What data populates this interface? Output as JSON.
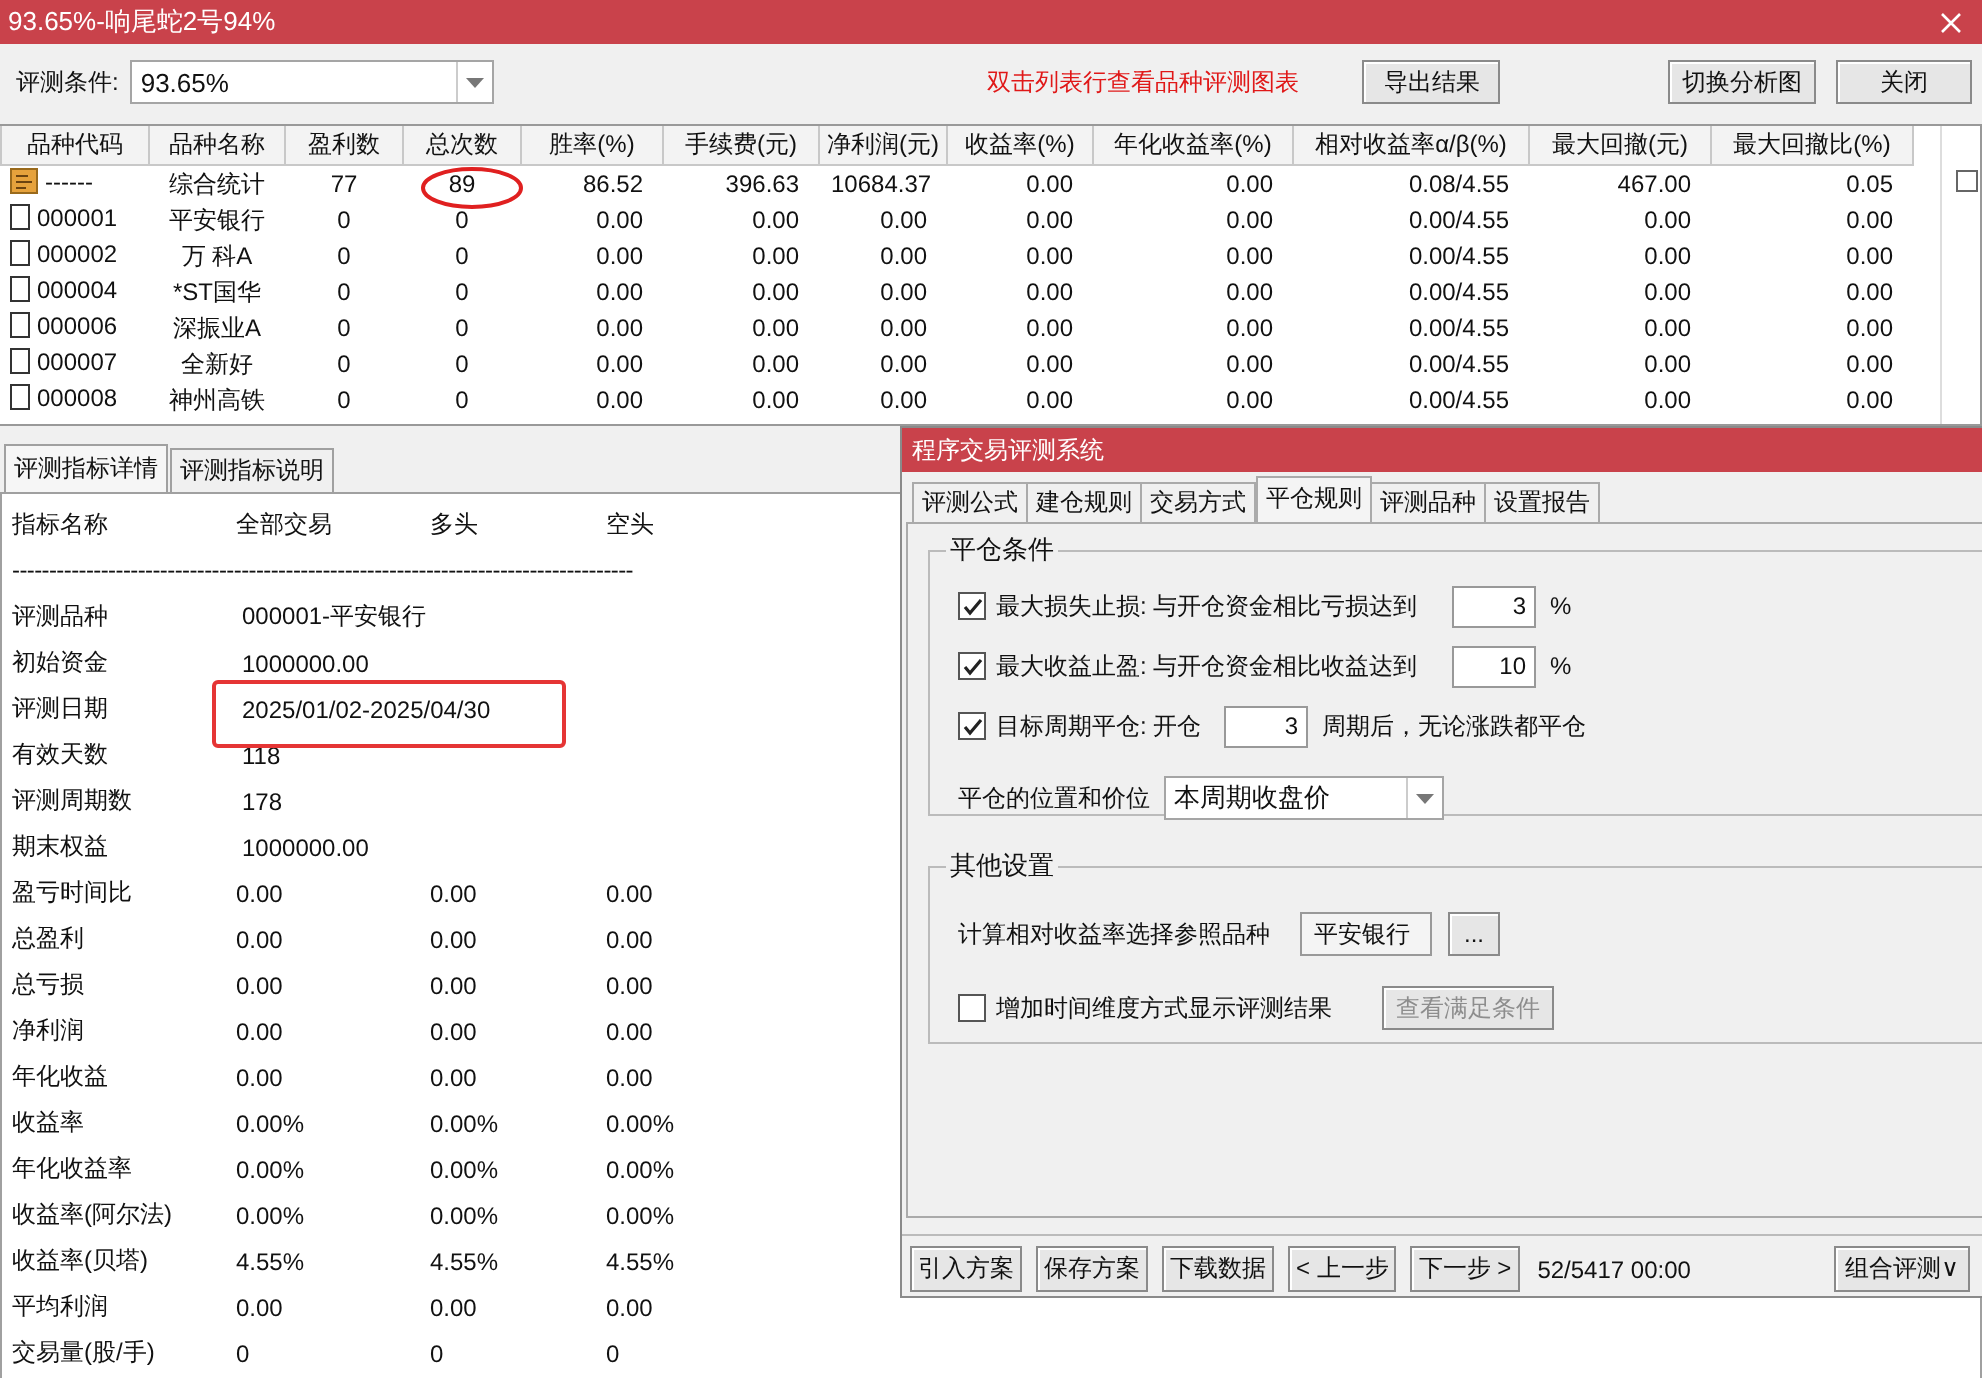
{
  "window": {
    "title": "93.65%-响尾蛇2号94%"
  },
  "toolbar": {
    "condition_label": "评测条件:",
    "condition_value": "93.65%",
    "hint": "双击列表行查看品种评测图表",
    "export_button": "导出结果",
    "right_buttons": [
      "切换分析图",
      "关闭"
    ]
  },
  "table": {
    "columns": [
      "品种代码",
      "品种名称",
      "盈利数",
      "总次数",
      "胜率(%)",
      "手续费(元)",
      "净利润(元)",
      "收益率(%)",
      "年化收益率(%)",
      "相对收益率α/β(%)",
      "最大回撤(元)",
      "最大回撤比(%)"
    ],
    "rows": [
      {
        "kind": "summary",
        "cells": [
          "------",
          "综合统计",
          "77",
          "89",
          "86.52",
          "396.63",
          "10684.37",
          "0.00",
          "0.00",
          "0.08/4.55",
          "467.00",
          "0.05"
        ]
      },
      {
        "kind": "stock",
        "cells": [
          "000001",
          "平安银行",
          "0",
          "0",
          "0.00",
          "0.00",
          "0.00",
          "0.00",
          "0.00",
          "0.00/4.55",
          "0.00",
          "0.00"
        ]
      },
      {
        "kind": "stock",
        "cells": [
          "000002",
          "万 科A",
          "0",
          "0",
          "0.00",
          "0.00",
          "0.00",
          "0.00",
          "0.00",
          "0.00/4.55",
          "0.00",
          "0.00"
        ]
      },
      {
        "kind": "stock",
        "cells": [
          "000004",
          "*ST国华",
          "0",
          "0",
          "0.00",
          "0.00",
          "0.00",
          "0.00",
          "0.00",
          "0.00/4.55",
          "0.00",
          "0.00"
        ]
      },
      {
        "kind": "stock",
        "cells": [
          "000006",
          "深振业A",
          "0",
          "0",
          "0.00",
          "0.00",
          "0.00",
          "0.00",
          "0.00",
          "0.00/4.55",
          "0.00",
          "0.00"
        ]
      },
      {
        "kind": "stock",
        "cells": [
          "000007",
          "全新好",
          "0",
          "0",
          "0.00",
          "0.00",
          "0.00",
          "0.00",
          "0.00",
          "0.00/4.55",
          "0.00",
          "0.00"
        ]
      },
      {
        "kind": "stock",
        "cells": [
          "000008",
          "神州高铁",
          "0",
          "0",
          "0.00",
          "0.00",
          "0.00",
          "0.00",
          "0.00",
          "0.00/4.55",
          "0.00",
          "0.00"
        ]
      }
    ]
  },
  "detail": {
    "tabs": [
      {
        "label": "评测指标详情",
        "selected": true
      },
      {
        "label": "评测指标说明",
        "selected": false
      }
    ],
    "header": [
      "指标名称",
      "全部交易",
      "多头",
      "空头"
    ],
    "divider": "------------------------------------------------------------------------------------",
    "rows": [
      {
        "label": "评测品种",
        "values": [
          "000001-平安银行"
        ]
      },
      {
        "label": "初始资金",
        "values": [
          "1000000.00"
        ]
      },
      {
        "label": "评测日期",
        "values": [
          "2025/01/02-2025/04/30"
        ]
      },
      {
        "label": "有效天数",
        "values": [
          "118"
        ]
      },
      {
        "label": "评测周期数",
        "values": [
          "178"
        ]
      },
      {
        "label": "期末权益",
        "values": [
          "1000000.00"
        ]
      },
      {
        "label": "盈亏时间比",
        "values": [
          "0.00",
          "0.00",
          "0.00"
        ]
      },
      {
        "label": "总盈利",
        "values": [
          "0.00",
          "0.00",
          "0.00"
        ]
      },
      {
        "label": "总亏损",
        "values": [
          "0.00",
          "0.00",
          "0.00"
        ]
      },
      {
        "label": "净利润",
        "values": [
          "0.00",
          "0.00",
          "0.00"
        ]
      },
      {
        "label": "年化收益",
        "values": [
          "0.00",
          "0.00",
          "0.00"
        ]
      },
      {
        "label": "收益率",
        "values": [
          "0.00%",
          "0.00%",
          "0.00%"
        ]
      },
      {
        "label": "年化收益率",
        "values": [
          "0.00%",
          "0.00%",
          "0.00%"
        ]
      },
      {
        "label": "收益率(阿尔法)",
        "values": [
          "0.00%",
          "0.00%",
          "0.00%"
        ]
      },
      {
        "label": "收益率(贝塔)",
        "values": [
          "4.55%",
          "4.55%",
          "4.55%"
        ]
      },
      {
        "label": "平均利润",
        "values": [
          "0.00",
          "0.00",
          "0.00"
        ]
      },
      {
        "label": "交易量(股/手)",
        "values": [
          "0",
          "0",
          "0"
        ]
      }
    ]
  },
  "dialog": {
    "title": "程序交易评测系统",
    "tabs": [
      {
        "label": "评测公式",
        "selected": false
      },
      {
        "label": "建仓规则",
        "selected": false
      },
      {
        "label": "交易方式",
        "selected": false
      },
      {
        "label": "平仓规则",
        "selected": true
      },
      {
        "label": "评测品种",
        "selected": false
      },
      {
        "label": "设置报告",
        "selected": false
      }
    ],
    "close_group": {
      "title": "平仓条件",
      "rules": [
        {
          "kind": "threshold",
          "checked": true,
          "label": "最大损失止损: 与开仓资金相比亏损达到",
          "value": "3",
          "unit": "%"
        },
        {
          "kind": "threshold",
          "checked": true,
          "label": "最大收益止盈: 与开仓资金相比收益达到",
          "value": "10",
          "unit": "%"
        },
        {
          "kind": "inline",
          "checked": true,
          "label": "目标周期平仓: 开仓",
          "value": "3",
          "unit": "周期后，无论涨跌都平仓"
        }
      ],
      "position_label": "平仓的位置和价位",
      "position_value": "本周期收盘价"
    },
    "other_group": {
      "title": "其他设置",
      "ref_label": "计算相对收益率选择参照品种",
      "ref_value": "平安银行",
      "browse": "...",
      "time_option": {
        "checked": false,
        "label": "增加时间维度方式显示评测结果"
      },
      "condition_button": {
        "label": "查看满足条件",
        "disabled": true
      }
    },
    "footer": {
      "buttons": [
        "引入方案",
        "保存方案",
        "下载数据",
        "< 上一步",
        "下一步 >"
      ],
      "status": "52/5417 00:00",
      "combo_button": "组合评测∨"
    }
  }
}
